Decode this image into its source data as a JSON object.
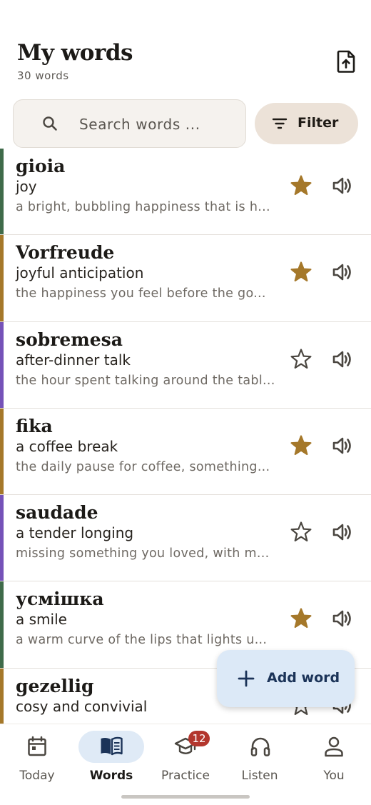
{
  "header": {
    "title": "My words",
    "subtitle": "30 words",
    "export_icon": "file-upload-icon"
  },
  "search": {
    "placeholder": "Search words ...",
    "value": ""
  },
  "filter": {
    "label": "Filter"
  },
  "colors": {
    "star_filled": "#a5782a",
    "icon_gray": "#4a4640",
    "accent_blue": "#1b3358"
  },
  "words": [
    {
      "word": "gioia",
      "meaning": "joy",
      "description": "a bright, bubbling happiness that is h...",
      "starred": true,
      "bar_color": "#3f6b4a"
    },
    {
      "word": "Vorfreude",
      "meaning": "joyful anticipation",
      "description": "the happiness you feel before the go...",
      "starred": true,
      "bar_color": "#a5782a"
    },
    {
      "word": "sobremesa",
      "meaning": "after-dinner talk",
      "description": "the hour spent talking around the tabl...",
      "starred": false,
      "bar_color": "#7552b8"
    },
    {
      "word": "fika",
      "meaning": "a coffee break",
      "description": "the daily pause for coffee, something...",
      "starred": true,
      "bar_color": "#a5782a"
    },
    {
      "word": "saudade",
      "meaning": "a tender longing",
      "description": "missing something you loved, with m...",
      "starred": false,
      "bar_color": "#7552b8"
    },
    {
      "word": "усмішка",
      "meaning": "a smile",
      "description": "a warm curve of the lips that lights u...",
      "starred": true,
      "bar_color": "#3f6b4a"
    },
    {
      "word": "gezellig",
      "meaning": "cosy and convivial",
      "description": "",
      "starred": false,
      "bar_color": "#a5782a"
    }
  ],
  "fab": {
    "label": "Add word"
  },
  "nav": {
    "items": [
      {
        "label": "Today",
        "icon": "calendar-icon",
        "active": false
      },
      {
        "label": "Words",
        "icon": "open-book-icon",
        "active": true
      },
      {
        "label": "Practice",
        "icon": "graduation-cap-icon",
        "active": false,
        "badge": "12"
      },
      {
        "label": "Listen",
        "icon": "headphones-icon",
        "active": false
      },
      {
        "label": "You",
        "icon": "person-icon",
        "active": false
      }
    ]
  }
}
